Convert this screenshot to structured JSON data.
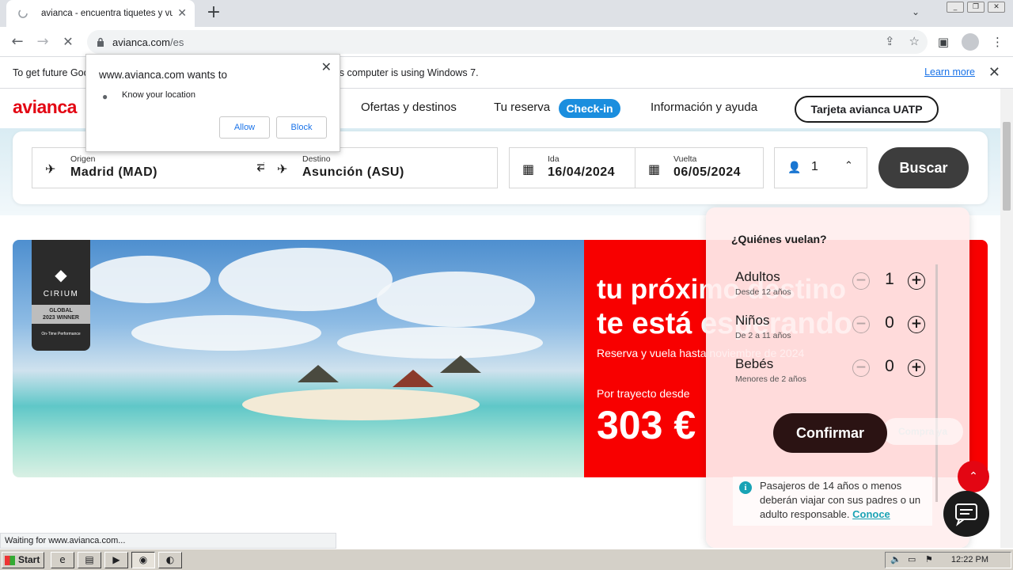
{
  "browser": {
    "tab_title": "avianca - encuentra tiquetes y vuelos",
    "url_host": "avianca.com",
    "url_path": "/es",
    "infobar_text": "To get future Google Chrome updates, you'll need Windows 10 or later. This computer is using Windows 7.",
    "infobar_link": "Learn more",
    "status_text": "Waiting for www.avianca.com..."
  },
  "permission": {
    "title": "www.avianca.com wants to",
    "request": "Know your location",
    "allow": "Allow",
    "block": "Block"
  },
  "site": {
    "logo": "avianca",
    "nav": {
      "ofertas": "Ofertas y destinos",
      "reserva": "Tu reserva",
      "checkin": "Check-in",
      "info": "Información y ayuda",
      "uatp": "Tarjeta avianca UATP"
    },
    "search": {
      "origin_label": "Origen",
      "origin_value": "Madrid (MAD)",
      "dest_label": "Destino",
      "dest_value": "Asunción (ASU)",
      "ida_label": "Ida",
      "ida_value": "16/04/2024",
      "vuelta_label": "Vuelta",
      "vuelta_value": "06/05/2024",
      "passengers": "1",
      "buscar": "Buscar"
    },
    "banner": {
      "badge_brand": "CIRIUM",
      "badge_global": "GLOBAL",
      "badge_winner": "2023 WINNER",
      "badge_caption": "On-Time Performance",
      "headline_1": "tu próximo destino",
      "headline_2": "te está esperando",
      "subline": "Reserva y vuela hasta noviembre de 2024",
      "per_trip": "Por trayecto desde",
      "price": "303 €"
    },
    "pax": {
      "title": "¿Quiénes vuelan?",
      "rows": [
        {
          "name": "Adultos",
          "sub": "Desde 12 años",
          "count": "1"
        },
        {
          "name": "Niños",
          "sub": "De 2 a 11 años",
          "count": "0"
        },
        {
          "name": "Bebés",
          "sub": "Menores de 2 años",
          "count": "0"
        }
      ],
      "confirm": "Confirmar",
      "compra": "Compra ya",
      "note": "Pasajeros de 14 años o menos deberán viajar con sus padres o un adulto responsable.",
      "note_link": "Conoce"
    }
  },
  "taskbar": {
    "start": "Start",
    "clock": "12:22 PM"
  }
}
